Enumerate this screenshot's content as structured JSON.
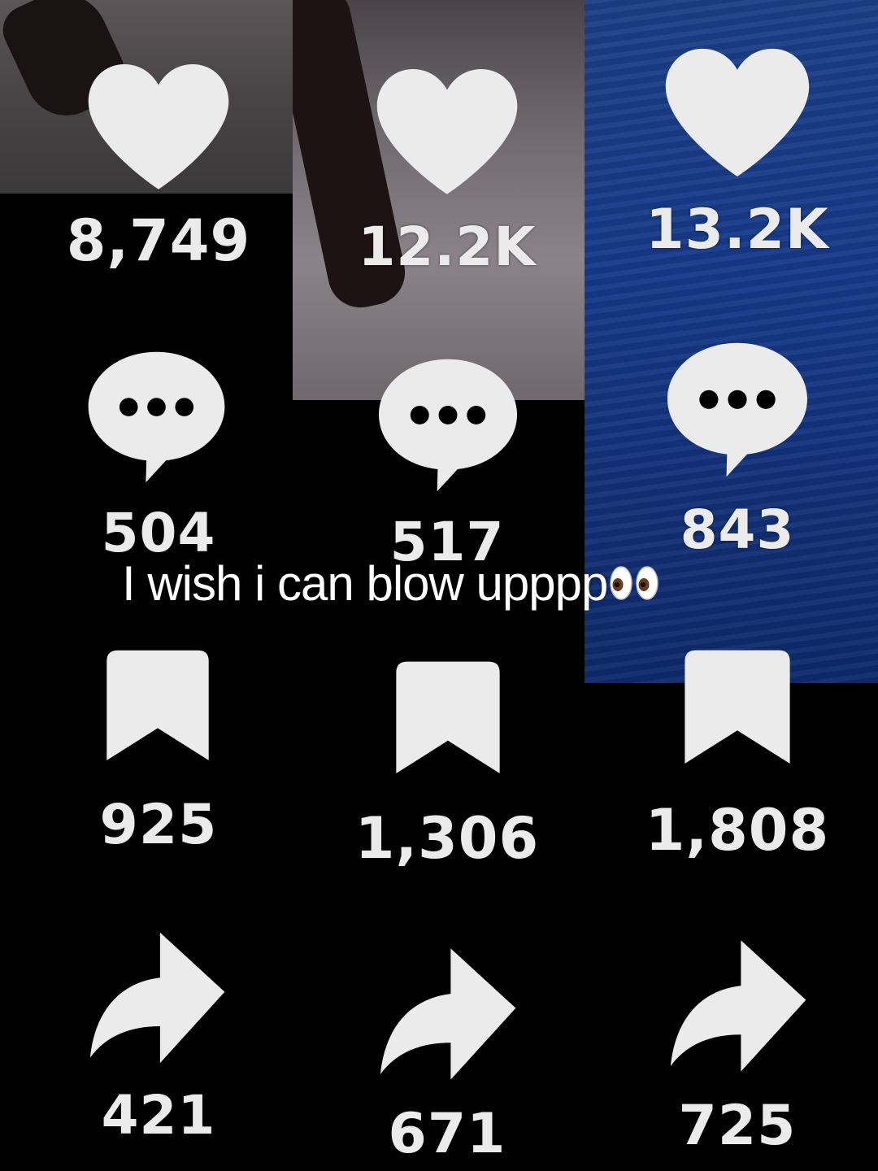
{
  "caption": {
    "text": "I wish i can blow upppp",
    "emoji_icon": "eyes-emoji-icon"
  },
  "columns": [
    {
      "likes": "8,749",
      "comments": "504",
      "saves": "925",
      "shares": "421"
    },
    {
      "likes": "12.2K",
      "comments": "517",
      "saves": "1,306",
      "shares": "671"
    },
    {
      "likes": "13.2K",
      "comments": "843",
      "saves": "1,808",
      "shares": "725"
    }
  ],
  "icons": {
    "like": "heart-icon",
    "comment": "comment-bubble-icon",
    "save": "bookmark-icon",
    "share": "share-arrow-icon"
  },
  "colors": {
    "icon_fill": "#ebebeb",
    "background": "#000000",
    "blue_thumbnail": "#1a3c84"
  }
}
